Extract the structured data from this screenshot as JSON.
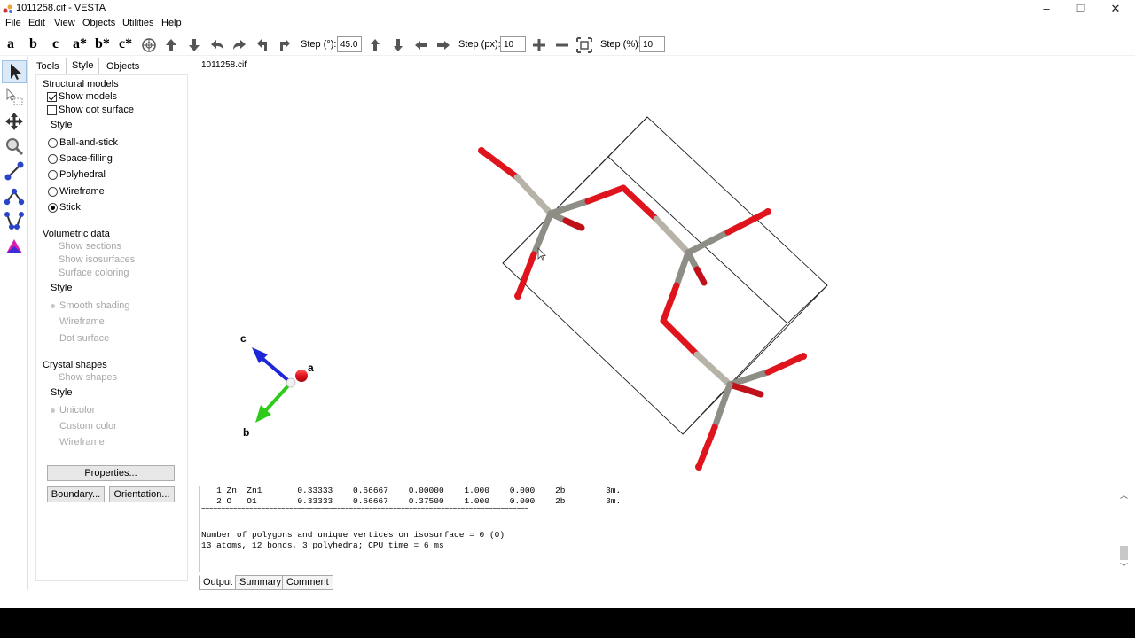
{
  "window": {
    "title": "1011258.cif - VESTA",
    "minimize": "–",
    "restore": "❐",
    "close": "✕"
  },
  "menu": [
    "File",
    "Edit",
    "View",
    "Objects",
    "Utilities",
    "Help"
  ],
  "toolbar": {
    "axis_buttons": [
      "a",
      "b",
      "c",
      "a*",
      "b*",
      "c*"
    ],
    "step_deg_label": "Step (°):",
    "step_deg_value": "45.0",
    "step_px_label": "Step (px):",
    "step_px_value": "10",
    "step_pct_label": "Step (%):",
    "step_pct_value": "10"
  },
  "side_tabs": [
    "Tools",
    "Style",
    "Objects"
  ],
  "structural_models": {
    "title": "Structural models",
    "show_models": "Show models",
    "show_dot_surface": "Show dot surface",
    "style_label": "Style",
    "styles": [
      "Ball-and-stick",
      "Space-filling",
      "Polyhedral",
      "Wireframe",
      "Stick"
    ],
    "selected_style": "Stick"
  },
  "volumetric": {
    "title": "Volumetric data",
    "show_sections": "Show sections",
    "show_isosurfaces": "Show isosurfaces",
    "surface_coloring": "Surface coloring",
    "style_label": "Style",
    "styles": [
      "Smooth shading",
      "Wireframe",
      "Dot surface"
    ]
  },
  "crystal_shapes": {
    "title": "Crystal shapes",
    "show_shapes": "Show shapes",
    "style_label": "Style",
    "styles": [
      "Unicolor",
      "Custom color",
      "Wireframe"
    ]
  },
  "buttons": {
    "properties": "Properties...",
    "boundary": "Boundary...",
    "orientation": "Orientation..."
  },
  "viewer": {
    "file_tab": "1011258.cif",
    "axis_labels": {
      "a": "a",
      "b": "b",
      "c": "c"
    },
    "colors": {
      "oxygen": "#e0141c",
      "zinc": "#8e8e86",
      "cell": "#222222",
      "axis_a": "#e0141c",
      "axis_b": "#2ecc1a",
      "axis_c": "#1c27d8"
    }
  },
  "output": {
    "lines": [
      "   1 Zn  Zn1       0.33333    0.66667    0.00000    1.000    0.000    2b        3m.",
      "   2 O   O1        0.33333    0.66667    0.37500    1.000    0.000    2b        3m.",
      "==================================================================================",
      "",
      "Number of polygons and unique vertices on isosurface = 0 (0)",
      "13 atoms, 12 bonds, 3 polyhedra; CPU time = 6 ms"
    ],
    "tabs": [
      "Output",
      "Summary",
      "Comment"
    ]
  }
}
